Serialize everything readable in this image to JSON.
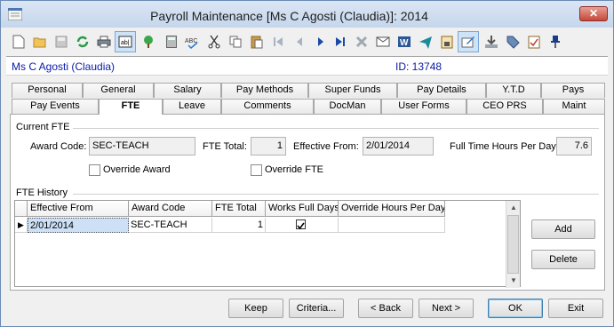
{
  "window": {
    "title": "Payroll Maintenance  [Ms C Agosti (Claudia)]:  2014",
    "close_label": "✕"
  },
  "toolbar": {
    "icons": [
      "new-icon",
      "open-icon",
      "save-icon",
      "refresh-icon",
      "print-icon",
      "text-field-icon",
      "tree-icon",
      "calculator-icon",
      "spell-check-icon",
      "cut-icon",
      "copy-icon",
      "paste-icon",
      "first-record-icon",
      "previous-record-icon",
      "next-record-icon",
      "last-record-icon",
      "delete-icon",
      "email-icon",
      "word-icon",
      "send-icon",
      "clipboard-lock-icon",
      "edit-notes-icon",
      "download-icon",
      "tag-icon",
      "checklist-icon",
      "pin-icon"
    ]
  },
  "employee": {
    "name": "Ms C Agosti (Claudia)",
    "id_label": "ID: 13748"
  },
  "tabs": {
    "row1": [
      "Personal",
      "General",
      "Salary",
      "Pay Methods",
      "Super Funds",
      "Pay Details",
      "Y.T.D",
      "Pays"
    ],
    "row2": [
      "Pay Events",
      "FTE",
      "Leave",
      "Comments",
      "DocMan",
      "User Forms",
      "CEO PRS",
      "Maint"
    ],
    "active": "FTE"
  },
  "current_fte": {
    "group_label": "Current FTE",
    "award_code_label": "Award Code:",
    "award_code_value": "SEC-TEACH",
    "fte_total_label": "FTE Total:",
    "fte_total_value": "1",
    "effective_from_label": "Effective From:",
    "effective_from_value": "2/01/2014",
    "full_time_hours_label": "Full Time Hours Per Day:",
    "full_time_hours_value": "7.6",
    "override_award_label": "Override Award",
    "override_award_checked": false,
    "override_fte_label": "Override FTE",
    "override_fte_checked": false
  },
  "fte_history": {
    "group_label": "FTE History",
    "columns": [
      "Effective From",
      "Award Code",
      "FTE Total",
      "Works Full Days",
      "Override Hours Per Day"
    ],
    "rows": [
      {
        "effective_from": "2/01/2014",
        "award_code": "SEC-TEACH",
        "fte_total": "1",
        "works_full_days": true,
        "override_hours_per_day": ""
      }
    ],
    "row_indicator": "▶"
  },
  "side_buttons": {
    "add": "Add",
    "delete": "Delete"
  },
  "footer_buttons": {
    "keep": "Keep",
    "criteria": "Criteria...",
    "back": "< Back",
    "next": "Next >",
    "ok": "OK",
    "exit": "Exit"
  },
  "colors": {
    "accent_text": "#0a1aa8",
    "selected_row": "#cde0f6",
    "window_border": "#6b8bb5"
  }
}
